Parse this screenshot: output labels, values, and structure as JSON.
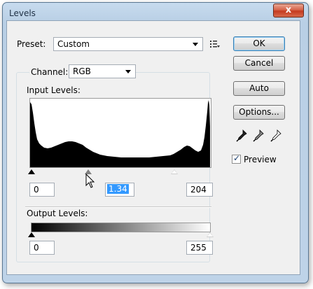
{
  "window": {
    "title": "Levels",
    "close_glyph": "x"
  },
  "preset": {
    "label": "Preset:",
    "value": "Custom",
    "menu_icon": "list-menu-icon"
  },
  "channel": {
    "label": "Channel:",
    "value": "RGB"
  },
  "input_levels": {
    "label": "Input Levels:",
    "black": "0",
    "gamma": "1.34",
    "white": "204"
  },
  "output_levels": {
    "label": "Output Levels:",
    "black": "0",
    "white": "255"
  },
  "buttons": {
    "ok": "OK",
    "cancel": "Cancel",
    "auto": "Auto",
    "options": "Options..."
  },
  "eyedroppers": [
    "black-eyedropper-icon",
    "gray-eyedropper-icon",
    "white-eyedropper-icon"
  ],
  "preview": {
    "label": "Preview",
    "checked": true
  },
  "colors": {
    "title_bar": "#bdd3ea",
    "close_button": "#c9452a",
    "histogram": "#000000",
    "selection": "#3399ff"
  }
}
